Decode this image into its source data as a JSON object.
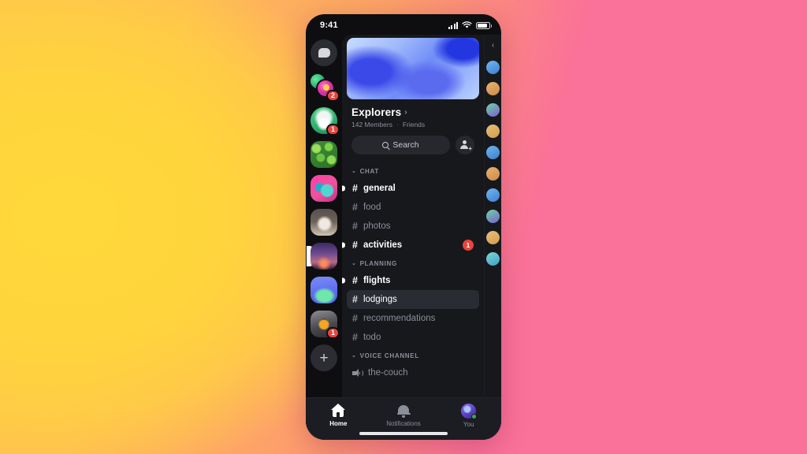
{
  "status_bar": {
    "time": "9:41",
    "icons": [
      "cellular-bars-icon",
      "wifi-icon",
      "battery-icon"
    ]
  },
  "server_rail": {
    "items": [
      {
        "name": "direct-messages",
        "kind": "dm-home",
        "badge": ""
      },
      {
        "name": "dm-group-stack",
        "kind": "stack",
        "badge": "2"
      },
      {
        "name": "server-cat-mascot",
        "kind": "circle",
        "fill": "g-cat",
        "badge": "1"
      },
      {
        "name": "server-leaf",
        "kind": "square",
        "fill": "g-leaf",
        "badge": ""
      },
      {
        "name": "server-pink-frog",
        "kind": "square",
        "fill": "g-pinkfrog",
        "badge": ""
      },
      {
        "name": "server-cat-photo",
        "kind": "square",
        "fill": "g-catphoto",
        "badge": ""
      },
      {
        "name": "server-explorers",
        "kind": "square",
        "fill": "g-night",
        "badge": "",
        "selected": true
      },
      {
        "name": "server-blob",
        "kind": "square",
        "fill": "g-blob",
        "badge": ""
      },
      {
        "name": "server-robot",
        "kind": "square",
        "fill": "g-robot",
        "badge": "1"
      }
    ],
    "add_label": "+"
  },
  "guild": {
    "banner": "blue-abstract-banner",
    "name": "Explorers",
    "chevron": "›",
    "member_count": "142 Members",
    "separator": "·",
    "relationship": "Friends"
  },
  "search": {
    "placeholder": "Search",
    "label": "Search",
    "add_people_plus": "+"
  },
  "channel_groups": [
    {
      "label": "CHAT",
      "chevron": "⌄",
      "channels": [
        {
          "name": "general",
          "hash": "#",
          "state": "unread",
          "badge": ""
        },
        {
          "name": "food",
          "hash": "#",
          "state": "read",
          "badge": ""
        },
        {
          "name": "photos",
          "hash": "#",
          "state": "read",
          "badge": ""
        },
        {
          "name": "activities",
          "hash": "#",
          "state": "unread",
          "badge": "1"
        }
      ]
    },
    {
      "label": "PLANNING",
      "chevron": "⌄",
      "channels": [
        {
          "name": "flights",
          "hash": "#",
          "state": "unread",
          "badge": ""
        },
        {
          "name": "lodgings",
          "hash": "#",
          "state": "active",
          "badge": ""
        },
        {
          "name": "recommendations",
          "hash": "#",
          "state": "read",
          "badge": ""
        },
        {
          "name": "todo",
          "hash": "#",
          "state": "read",
          "badge": ""
        }
      ]
    },
    {
      "label": "VOICE CHANNEL",
      "chevron": "⌄",
      "channels": [
        {
          "name": "the-couch",
          "hash": "speaker",
          "state": "read",
          "badge": ""
        }
      ]
    }
  ],
  "members_panel": {
    "collapse_chevron": "‹",
    "avatars": [
      "b",
      "o",
      "g",
      "y",
      "b",
      "o",
      "b",
      "g",
      "y"
    ]
  },
  "tab_bar": {
    "tabs": [
      {
        "label": "Home",
        "icon": "home-icon",
        "active": true
      },
      {
        "label": "Notifications",
        "icon": "bell-icon",
        "active": false
      },
      {
        "label": "You",
        "icon": "avatar-icon",
        "active": false
      }
    ]
  },
  "colors": {
    "badge_red": "#e8453c",
    "status_green": "#3ba55d",
    "surface": "#17181c",
    "rail": "#0e0e11",
    "active_channel": "#2a2c33",
    "bg_yellow": "#FFD53B",
    "bg_pink": "#FA7199"
  }
}
